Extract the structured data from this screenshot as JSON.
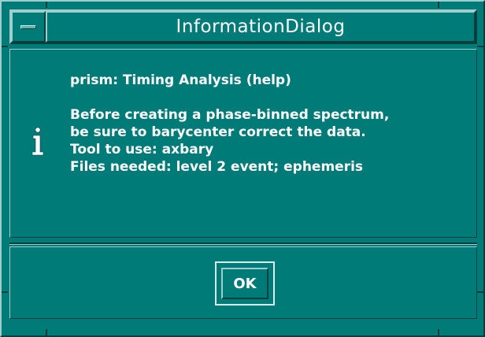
{
  "window": {
    "title": "InformationDialog",
    "menu_icon": "window-menu-icon",
    "background": "#007b78",
    "highlight": "#9fcfcd",
    "shadow": "#003f3d"
  },
  "message": {
    "icon": "info-icon",
    "heading": "prism: Timing Analysis (help)",
    "lines": [
      "Before creating a phase-binned spectrum,",
      "be sure to barycenter correct the data.",
      "Tool to use: axbary",
      "Files needed: level 2 event; ephemeris"
    ]
  },
  "actions": {
    "ok_label": "OK"
  }
}
